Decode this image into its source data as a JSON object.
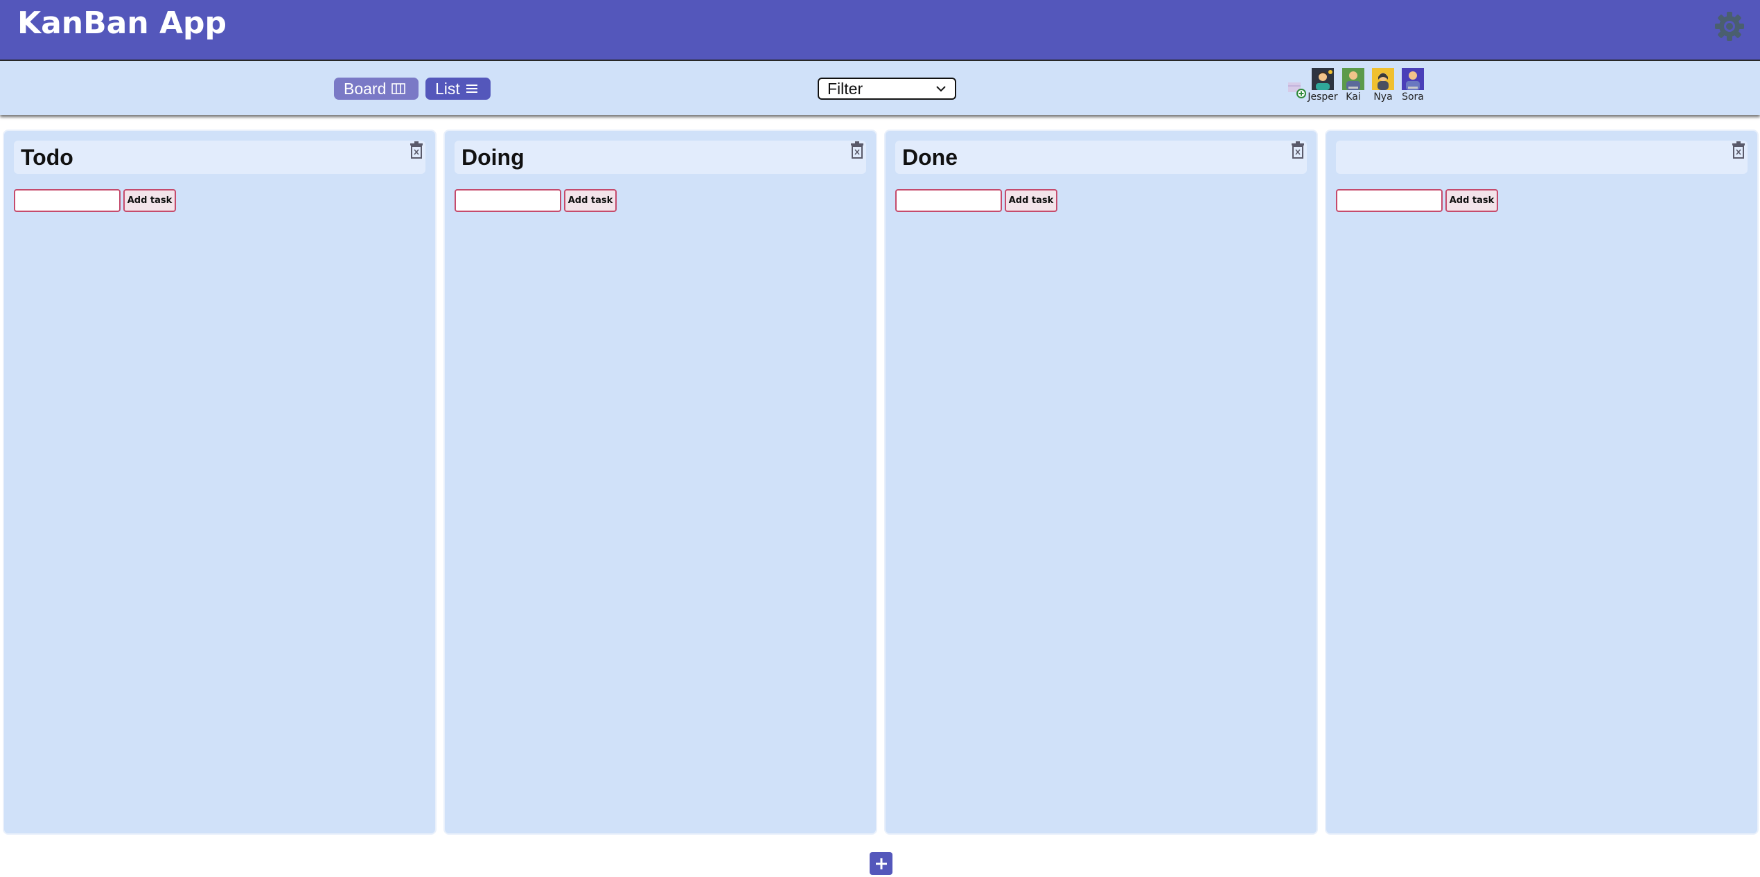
{
  "app": {
    "title": "KanBan App"
  },
  "icons": {
    "settings": "gear-icon",
    "add_user": "add-user-icon",
    "trash": "trash-icon",
    "add_column": "plus-icon"
  },
  "colors": {
    "header": "#5457bb",
    "board_bg": "#d0e1f9",
    "board_btn": "#7a79c6",
    "list_btn": "#5457bb",
    "input_border": "#c54b6c"
  },
  "toolbar": {
    "board_label": "Board",
    "list_label": "List",
    "filter_label": "Filter"
  },
  "users": [
    {
      "name": "Jesper",
      "bg": "#2e3440"
    },
    {
      "name": "Kai",
      "bg": "#5c9a4a"
    },
    {
      "name": "Nya",
      "bg": "#f0c030"
    },
    {
      "name": "Sora",
      "bg": "#4a3fb8"
    }
  ],
  "columns": [
    {
      "title": "Todo",
      "add_task_label": "Add task",
      "input_value": ""
    },
    {
      "title": "Doing",
      "add_task_label": "Add task",
      "input_value": ""
    },
    {
      "title": "Done",
      "add_task_label": "Add task",
      "input_value": ""
    },
    {
      "title": "",
      "add_task_label": "Add task",
      "input_value": ""
    }
  ]
}
